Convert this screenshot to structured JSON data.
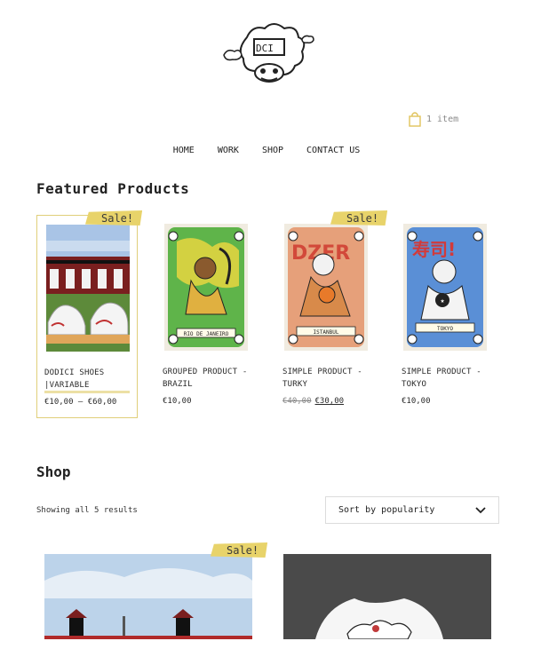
{
  "header": {
    "cart_label": "1 item"
  },
  "nav": {
    "items": [
      "HOME",
      "WORK",
      "SHOP",
      "CONTACT US"
    ]
  },
  "featured": {
    "title": "Featured Products",
    "sale_badge": "Sale!",
    "products": [
      {
        "name": "DODICI SHOES |VARIABLE",
        "price": "€10,00 – €60,00",
        "old_price": "",
        "sale": true
      },
      {
        "name": "GROUPED PRODUCT - BRAZIL",
        "price": "€10,00",
        "old_price": "",
        "sale": false,
        "poster_caption": "RIO DE JANEIRO"
      },
      {
        "name": "SIMPLE PRODUCT - TURKY",
        "price": "€30,00",
        "old_price": "€40,00",
        "sale": true,
        "poster_caption": "ISTANBUL"
      },
      {
        "name": "SIMPLE PRODUCT - TOKYO",
        "price": "€10,00",
        "old_price": "",
        "sale": false,
        "poster_caption": "TOKYO"
      }
    ]
  },
  "shop": {
    "title": "Shop",
    "results_text": "Showing all 5 results",
    "sort_label": "Sort by popularity",
    "sale_badge": "Sale!"
  },
  "colors": {
    "accent_yellow": "#e8d36a",
    "highlight": "#ece0a5",
    "border_gold": "#e0cf7a"
  }
}
